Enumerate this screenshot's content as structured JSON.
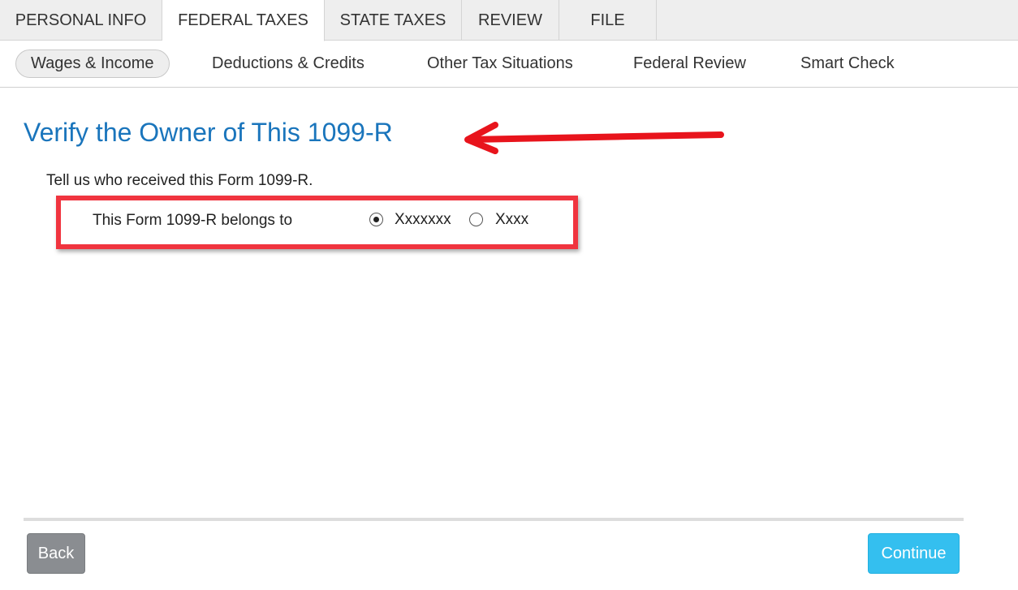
{
  "top_tabs": [
    {
      "label": "PERSONAL INFO",
      "active": false
    },
    {
      "label": "FEDERAL TAXES",
      "active": true
    },
    {
      "label": "STATE TAXES",
      "active": false
    },
    {
      "label": "REVIEW",
      "active": false
    },
    {
      "label": "FILE",
      "active": false
    }
  ],
  "sub_nav": [
    {
      "label": "Wages & Income",
      "active": true
    },
    {
      "label": "Deductions & Credits",
      "active": false
    },
    {
      "label": "Other Tax Situations",
      "active": false
    },
    {
      "label": "Federal Review",
      "active": false
    },
    {
      "label": "Smart Check",
      "active": false
    }
  ],
  "main": {
    "title": "Verify the Owner of This 1099-R",
    "intro": "Tell us who received this Form 1099-R.",
    "question_label": "This Form 1099-R belongs to",
    "options": [
      {
        "label": "Xxxxxxx",
        "selected": true
      },
      {
        "label": "Xxxx",
        "selected": false
      }
    ]
  },
  "footer": {
    "back_label": "Back",
    "continue_label": "Continue"
  },
  "colors": {
    "title": "#1a75bc",
    "annotation": "#e8141c",
    "continue_button": "#34bfef",
    "back_button": "#8a8d91"
  }
}
